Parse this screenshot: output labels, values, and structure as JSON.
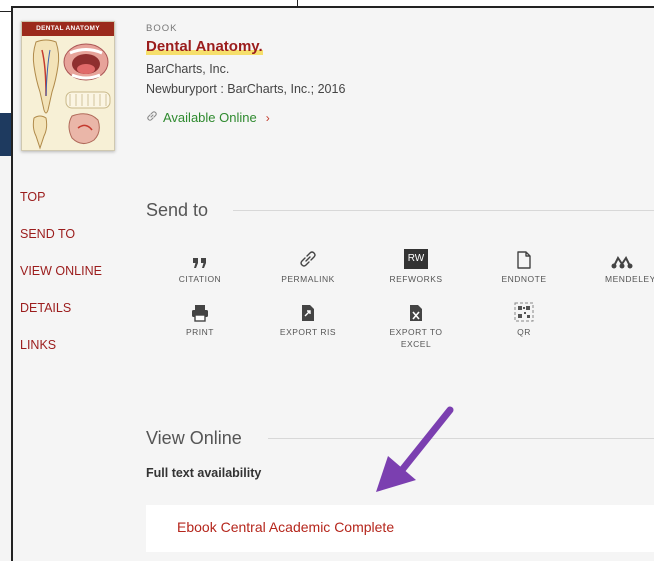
{
  "record": {
    "kind": "BOOK",
    "title": "Dental Anatomy.",
    "publisher": "BarCharts, Inc.",
    "pub_info": "Newburyport : BarCharts, Inc.; 2016",
    "available_label": "Available Online",
    "cover_title": "DENTAL ANATOMY"
  },
  "nav": {
    "items": [
      {
        "label": "TOP"
      },
      {
        "label": "SEND TO"
      },
      {
        "label": "VIEW ONLINE"
      },
      {
        "label": "DETAILS"
      },
      {
        "label": "LINKS"
      }
    ]
  },
  "send_to": {
    "heading": "Send to",
    "refworks_icon_text": "RW",
    "tools": [
      {
        "label": "CITATION",
        "icon": "quote-icon"
      },
      {
        "label": "PERMALINK",
        "icon": "link-icon"
      },
      {
        "label": "REFWORKS",
        "icon": "refworks-icon"
      },
      {
        "label": "ENDNOTE",
        "icon": "document-icon"
      },
      {
        "label": "MENDELEY",
        "icon": "mendeley-icon"
      },
      {
        "label": "PRINT",
        "icon": "printer-icon"
      },
      {
        "label": "EXPORT RIS",
        "icon": "export-file-icon"
      },
      {
        "label": "EXPORT TO EXCEL",
        "icon": "excel-icon"
      },
      {
        "label": "QR",
        "icon": "qr-code-icon"
      }
    ]
  },
  "view_online": {
    "heading": "View Online",
    "full_text_label": "Full text availability",
    "provider_link": "Ebook Central Academic Complete"
  },
  "colors": {
    "brand_red": "#9b1c1c",
    "available_green": "#2f8a2f",
    "annotation_arrow": "#7b3fb0",
    "highlight": "#f6df6b"
  }
}
